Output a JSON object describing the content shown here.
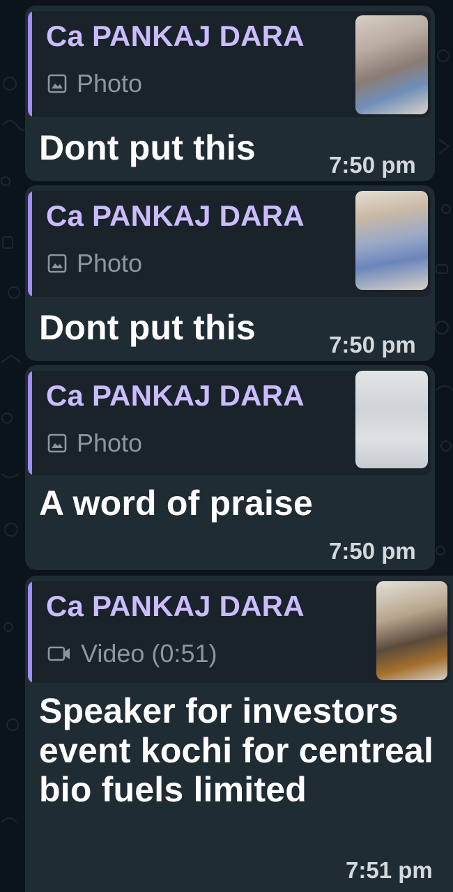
{
  "messages": [
    {
      "quote": {
        "sender": "Ca PANKAJ DARA",
        "media_icon": "image-icon",
        "media_label": "Photo"
      },
      "text": "Dont put this",
      "time": "7:50 pm"
    },
    {
      "quote": {
        "sender": "Ca PANKAJ DARA",
        "media_icon": "image-icon",
        "media_label": "Photo"
      },
      "text": "Dont put this",
      "time": "7:50 pm"
    },
    {
      "quote": {
        "sender": "Ca PANKAJ DARA",
        "media_icon": "image-icon",
        "media_label": "Photo"
      },
      "text": "A word of praise",
      "time": "7:50 pm"
    },
    {
      "quote": {
        "sender": "Ca PANKAJ DARA",
        "media_icon": "video-icon",
        "media_label": "Video (0:51)"
      },
      "text": "Speaker for investors event kochi for centreal bio fuels limited",
      "time": "7:51 pm"
    }
  ],
  "colors": {
    "chat_background": "#0b141a",
    "bubble": "#202c33",
    "quote_background": "#1a2329",
    "quote_accent": "#a08cf2",
    "sender_name": "#cbbcff",
    "media_label": "#8c979c",
    "message_text": "#ffffff",
    "timestamp": "#d3d8da"
  }
}
